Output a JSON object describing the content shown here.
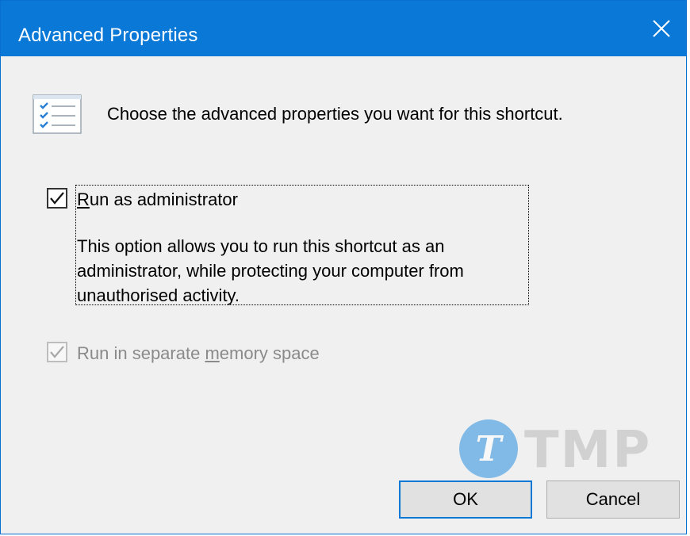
{
  "window": {
    "title": "Advanced Properties",
    "close_icon": "close-icon",
    "accent_color": "#0a78d7"
  },
  "header": {
    "icon": "checklist-icon",
    "text": "Choose the advanced properties you want for this shortcut."
  },
  "options": {
    "run_as_admin": {
      "checked": true,
      "enabled": true,
      "label_mnemonic": "R",
      "label_rest": "un as administrator",
      "description": "This option allows you to run this shortcut as an administrator, while protecting your computer from unauthorised activity."
    },
    "separate_memory": {
      "checked": true,
      "enabled": false,
      "label_before": "Run in separate ",
      "label_mnemonic": "m",
      "label_after": "emory space"
    }
  },
  "buttons": {
    "ok": "OK",
    "cancel": "Cancel"
  },
  "watermark": {
    "glyph": "T",
    "text": "TMP"
  }
}
